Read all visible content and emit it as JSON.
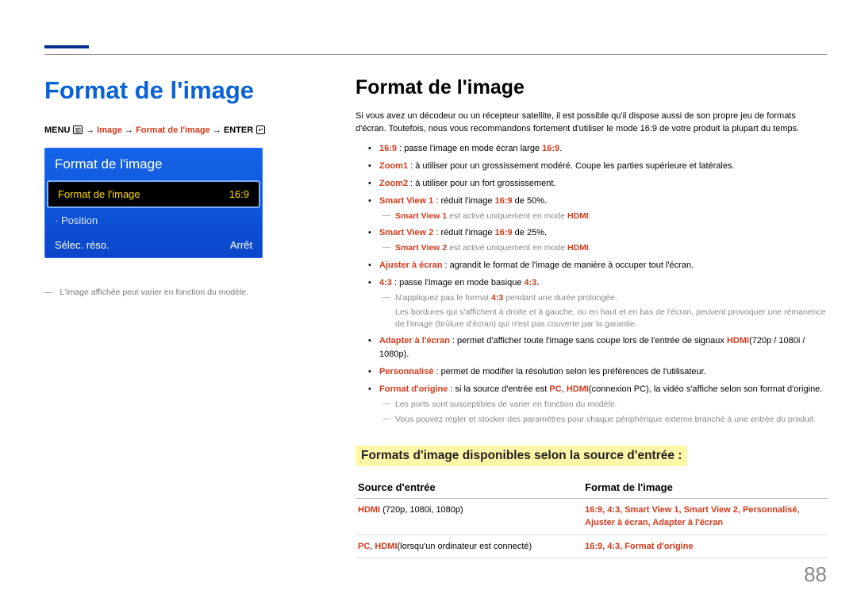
{
  "left": {
    "title": "Format de l'image",
    "breadcrumb": {
      "menu": "MENU",
      "arrow": "→",
      "image": "Image",
      "format": "Format de l'image",
      "enter": "ENTER"
    },
    "panel": {
      "header": "Format de l'image",
      "row_selected_label": "Format de l'image",
      "row_selected_value": "16:9",
      "row_position": "· Position",
      "row_reso_label": "Sélec. réso.",
      "row_reso_value": "Arrêt"
    },
    "caption_dash": "―",
    "caption": "L'image affichée peut varier en fonction du modèle."
  },
  "right": {
    "title": "Format de l'image",
    "intro": "Si vous avez un décodeur ou un récepteur satellite, il est possible qu'il dispose aussi de son propre jeu de formats d'écran. Toutefois, nous vous recommandons fortement d'utiliser le mode 16:9 de votre produit la plupart du temps.",
    "b1_term": "16:9",
    "b1_rest": " : passe l'image en mode écran large ",
    "b1_tail": "16:9",
    "b1_dot": ".",
    "b2_term": "Zoom1",
    "b2_rest": " : à utiliser pour un grossissement modéré. Coupe les parties supérieure et latérales.",
    "b3_term": "Zoom2",
    "b3_rest": " : à utiliser pour un fort grossissement.",
    "b4_term": "Smart View 1",
    "b4_rest": " : réduit l'image ",
    "b4_mid": "16:9",
    "b4_tail": " de 50%.",
    "n4_pre": "",
    "n4_a": "Smart View 1",
    "n4_mid": " est activé uniquement en mode ",
    "n4_b": "HDMI",
    "n4_dot": ".",
    "b5_term": "Smart View 2",
    "b5_rest": " : réduit l'image ",
    "b5_mid": "16:9",
    "b5_tail": " de 25%.",
    "n5_a": "Smart View 2",
    "n5_mid": " est activé uniquement en mode ",
    "n5_b": "HDMI",
    "n5_dot": ".",
    "b6_term": "Ajuster à écran",
    "b6_rest": " : agrandit le format de l'image de manière à occuper tout l'écran.",
    "b7_term": "4:3",
    "b7_rest": " : passe l'image en mode basique ",
    "b7_tail": "4:3",
    "b7_dot": ".",
    "n7_pre": "N'appliquez pas le format ",
    "n7_a": "4:3",
    "n7_post": " pendant une durée prolongée.",
    "n7_extra": "Les bordures qui s'affichent à droite et à gauche, ou en haut et en bas de l'écran, peuvent provoquer une rémanence de l'image (brûlure d'écran) qui n'est pas couverte par la garantie.",
    "b8_term": "Adapter à l'écran",
    "b8_rest": " : permet d'afficher toute l'image sans coupe lors de l'entrée de signaux ",
    "b8_mid": "HDMI",
    "b8_tail": "(720p / 1080i / 1080p).",
    "b9_term": "Personnalisé",
    "b9_rest": " : permet de modifier la résolution selon les préférences de l'utilisateur.",
    "b10_term": "Format d'origine",
    "b10_rest": " : si la source d'entrée est ",
    "b10_a": "PC",
    "b10_mid": ", ",
    "b10_b": "HDMI",
    "b10_rest2": "(connexion PC), la vidéo s'affiche selon son format d'origine.",
    "n10a": "Les ports sont susceptibles de varier en fonction du modèle.",
    "n10b": "Vous pouvez régler et stocker des paramètres pour chaque périphérique externe branché à une entrée du produit.",
    "section_hl": "Formats d'image disponibles selon la source d'entrée :",
    "table": {
      "th1": "Source d'entrée",
      "th2": "Format de l'image",
      "r1c1_a": "HDMI",
      "r1c1_b": " (720p, 1080i, 1080p)",
      "r1c2": "16:9, 4:3, Smart View 1, Smart View 2, Personnalisé, Ajuster à écran, Adapter à l'écran",
      "r2c1_a": "PC",
      "r2c1_mid": ", ",
      "r2c1_b": "HDMI",
      "r2c1_tail": "(lorsqu'un ordinateur est connecté)",
      "r2c2": "16:9, 4:3, Format d'origine"
    }
  },
  "page_num": "88"
}
